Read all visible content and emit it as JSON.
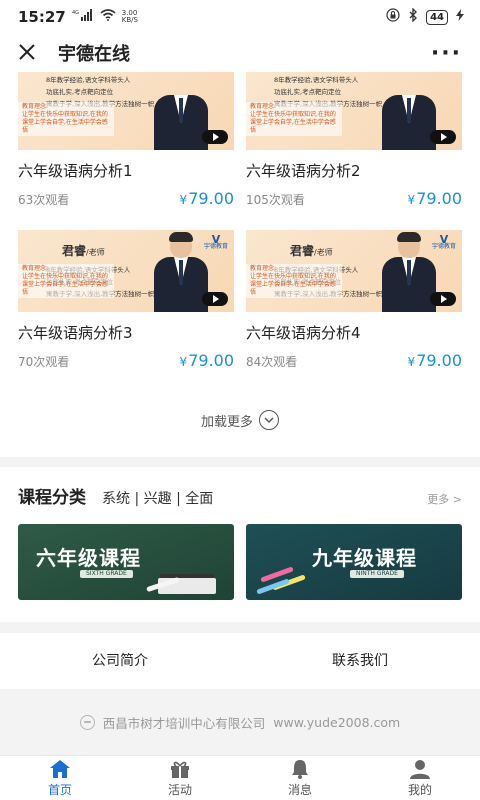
{
  "status_bar": {
    "time": "15:27",
    "network_speed": "3.00\nKB/S",
    "battery": "44"
  },
  "header": {
    "title": "宇德在线",
    "more": "···"
  },
  "courses": [
    {
      "title": "六年级语病分析1",
      "views": "63次观看",
      "price": "79.00"
    },
    {
      "title": "六年级语病分析2",
      "views": "105次观看",
      "price": "79.00"
    },
    {
      "title": "六年级语病分析3",
      "views": "70次观看",
      "price": "79.00"
    },
    {
      "title": "六年级语病分析4",
      "views": "84次观看",
      "price": "79.00"
    }
  ],
  "thumbnail": {
    "teacher_name": "君睿",
    "teacher_suffix": "/老师",
    "line1": "8年教学经验,语文学科带头人",
    "line2": "功底扎实,考点靶向定位",
    "line3": "寓教于学,深入浅出,教学方法独树一帜",
    "tag_title": "教育理念:",
    "tag_text": "让学生在快乐中获取知识,在我的课堂上学会自学,在生活中学会感悟",
    "logo_text": "宇德教育"
  },
  "price_symbol": "¥",
  "load_more": "加载更多",
  "category": {
    "title": "课程分类",
    "filters": "系统 | 兴趣 | 全面",
    "more": "更多 >",
    "cards": [
      {
        "label": "六年级课程",
        "sub": "SIXTH GRADE"
      },
      {
        "label": "九年级课程",
        "sub": "NINTH GRADE"
      }
    ]
  },
  "links": {
    "about": "公司简介",
    "contact": "联系我们"
  },
  "footer": {
    "company": "西昌市树才培训中心有限公司",
    "website": "www.yude2008.com"
  },
  "tabs": [
    {
      "label": "首页",
      "icon": "home-icon"
    },
    {
      "label": "活动",
      "icon": "gift-icon"
    },
    {
      "label": "消息",
      "icon": "bell-icon"
    },
    {
      "label": "我的",
      "icon": "user-icon"
    }
  ],
  "colors": {
    "price": "#1a8fd8",
    "tab_active": "#1a6fd0"
  }
}
